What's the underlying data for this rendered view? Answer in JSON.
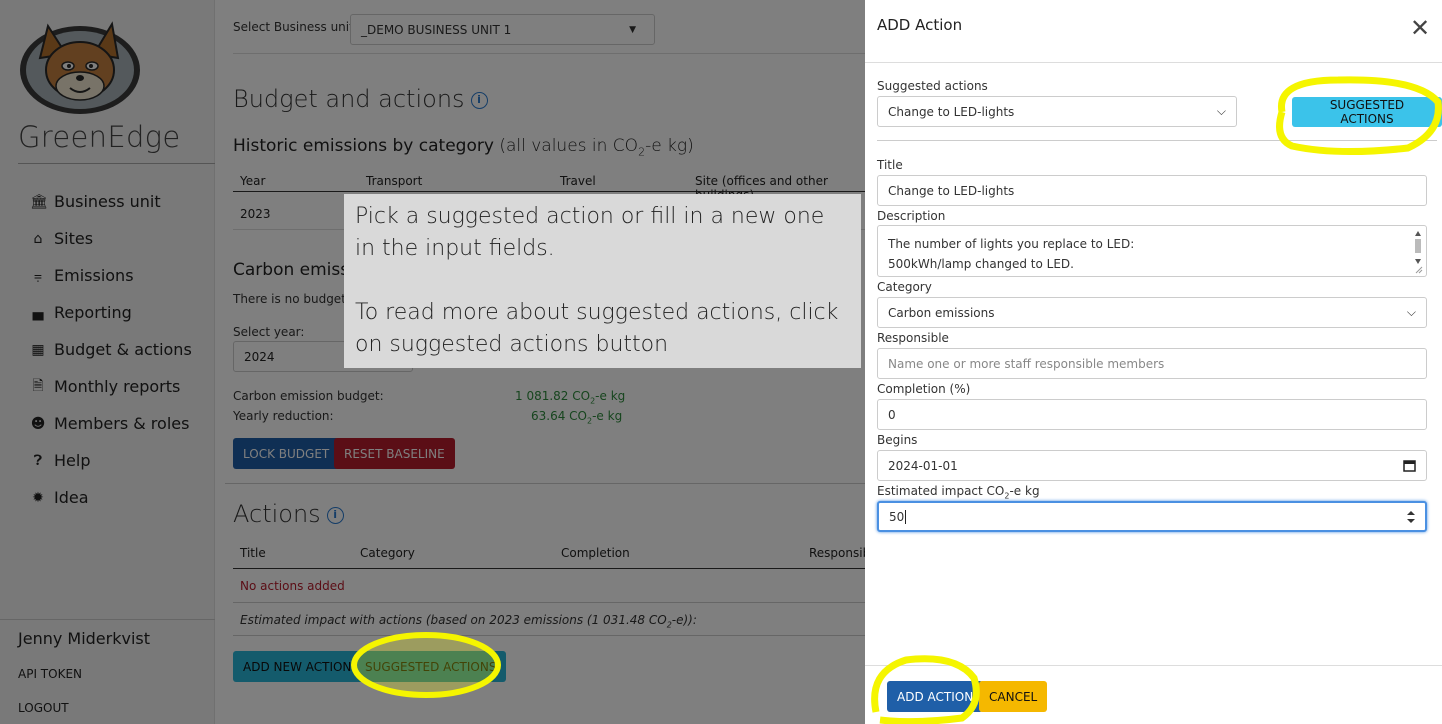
{
  "sidebar": {
    "brand": "GreenEdge",
    "items": [
      {
        "label": "Business unit",
        "icon": "bank-icon"
      },
      {
        "label": "Sites",
        "icon": "home-icon"
      },
      {
        "label": "Emissions",
        "icon": "factory-icon"
      },
      {
        "label": "Reporting",
        "icon": "chart-icon"
      },
      {
        "label": "Budget & actions",
        "icon": "calculator-icon"
      },
      {
        "label": "Monthly reports",
        "icon": "file-invoice-icon"
      },
      {
        "label": "Members & roles",
        "icon": "users-icon"
      },
      {
        "label": "Help",
        "icon": "question-icon"
      },
      {
        "label": "Idea",
        "icon": "lightbulb-icon"
      }
    ],
    "user_name": "Jenny Miderkvist",
    "api_token": "API TOKEN",
    "logout": "LOGOUT"
  },
  "main": {
    "business_unit_label": "Select Business unit",
    "business_unit_value": "_DEMO BUSINESS UNIT 1",
    "budget_title": "Budget and actions",
    "historic_title": "Historic emissions by category",
    "historic_sub_pre": "(all values in CO",
    "historic_sub_sub": "2",
    "historic_sub_post": "-e kg)",
    "historic_columns": [
      "Year",
      "Transport",
      "Travel",
      "Site (offices and other buildings)"
    ],
    "historic_rows": [
      [
        "2023"
      ]
    ],
    "carbon_title": "Carbon emissi",
    "no_budget_text": "There is no budget se",
    "select_year_label": "Select year:",
    "select_year_value": "2024",
    "carbon_budget_label": "Carbon emission budget:",
    "carbon_budget_value_pre": "1 081.82 CO",
    "carbon_budget_value_sub": "2",
    "carbon_budget_value_post": "-e kg",
    "yearly_reduction_label": "Yearly reduction:",
    "yearly_reduction_value_pre": "63.64 CO",
    "yearly_reduction_value_sub": "2",
    "yearly_reduction_value_post": "-e kg",
    "lock_budget": "LOCK BUDGET",
    "reset_baseline": "RESET BASELINE",
    "actions_title": "Actions",
    "actions_columns": [
      "Title",
      "Category",
      "Completion",
      "Responsibl"
    ],
    "no_actions": "No actions added",
    "estimated_impact_pre": "Estimated impact with actions (based on 2023 emissions (1 031.48 CO",
    "estimated_impact_sub": "2",
    "estimated_impact_post": "-e)):",
    "add_new_action": "ADD NEW ACTION",
    "suggested_actions": "SUGGESTED ACTIONS"
  },
  "tooltip": {
    "line1": "Pick a suggested action or fill in a new one in the input fields.",
    "line2": "To read more about suggested actions, click on suggested actions button"
  },
  "modal": {
    "title": "ADD Action",
    "suggested_label": "Suggested actions",
    "suggested_value": "Change to LED-lights",
    "suggested_button": "SUGGESTED ACTIONS",
    "title_label": "Title",
    "title_value": "Change to LED-lights",
    "description_label": "Description",
    "description_line1": "The number of lights you replace to LED:",
    "description_line2": "500kWh/lamp changed to LED.",
    "category_label": "Category",
    "category_value": "Carbon emissions",
    "responsible_label": "Responsible",
    "responsible_placeholder": "Name one or more staff responsible members",
    "completion_label": "Completion (%)",
    "completion_value": "0",
    "begins_label": "Begins",
    "begins_value": "2024-01-01",
    "impact_label_pre": "Estimated impact CO",
    "impact_label_sub": "2",
    "impact_label_post": "-e kg",
    "impact_value": "50",
    "add_action": "ADD ACTION",
    "cancel": "CANCEL"
  },
  "colors": {
    "highlight": "#f5f500",
    "primary_button": "#1f5fa8",
    "danger_button": "#b71c2c",
    "info_button": "#29b6d9",
    "warning_button": "#f5b800",
    "positive_value": "#2e8b3d"
  }
}
